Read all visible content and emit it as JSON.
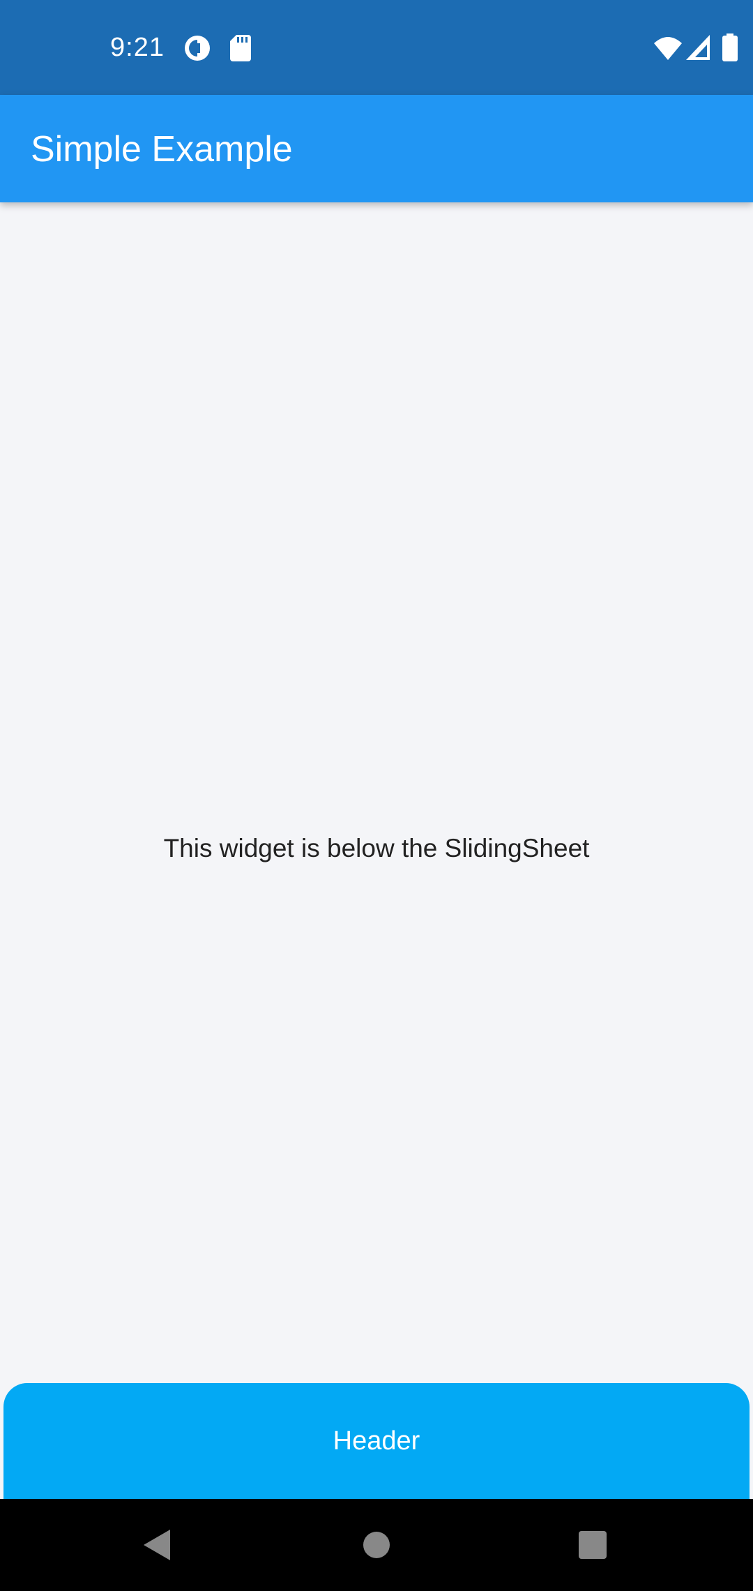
{
  "status_bar": {
    "time": "9:21",
    "left_icons": [
      "sync-icon",
      "sd-card-icon"
    ],
    "right_icons": [
      "wifi-icon",
      "signal-icon",
      "battery-icon"
    ],
    "color": "#1c6cb3"
  },
  "app_bar": {
    "title": "Simple Example",
    "color": "#2196f3"
  },
  "content": {
    "text": "This widget is below the SlidingSheet"
  },
  "sheet": {
    "header": "Header",
    "color": "#03a9f4"
  },
  "nav_bar": {
    "buttons": [
      "back-icon",
      "home-icon",
      "recents-icon"
    ]
  }
}
